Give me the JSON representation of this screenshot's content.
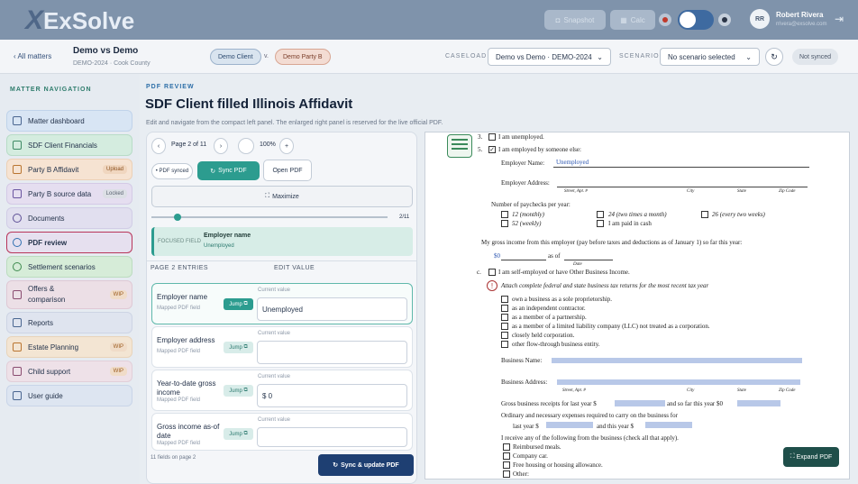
{
  "app": {
    "logo_x": "X",
    "logo_text": "ExSolve"
  },
  "topbar": {
    "snapshot": "Snapshot",
    "calc": "Calc",
    "user_initials": "RR",
    "user_name": "Robert Rivera",
    "user_email": "rrivera@exsolve.com"
  },
  "matter": {
    "all_matters": "‹ All matters",
    "title": "Demo vs Demo",
    "subtitle": "DEMO-2024 · Cook County",
    "party_a": "Demo Client",
    "vs": "v.",
    "party_b": "Demo Party B"
  },
  "caseload": {
    "label": "CASELOAD",
    "value": "Demo vs Demo · DEMO-2024",
    "scenario_label": "SCENARIO",
    "scenario_value": "No scenario selected",
    "sync_status": "Not synced"
  },
  "sidebar": {
    "title": "MATTER NAVIGATION",
    "items": [
      {
        "label": "Matter dashboard",
        "tag": ""
      },
      {
        "label": "SDF Client Financials",
        "tag": ""
      },
      {
        "label": "Party B Affidavit",
        "tag": "Upload"
      },
      {
        "label": "Party B source data",
        "tag": "Locked"
      },
      {
        "label": "Documents",
        "tag": ""
      },
      {
        "label": "PDF review",
        "tag": ""
      },
      {
        "label": "Settlement scenarios",
        "tag": ""
      },
      {
        "label": "Offers & comparison",
        "tag": "WIP"
      },
      {
        "label": "Reports",
        "tag": ""
      },
      {
        "label": "Estate Planning",
        "tag": "WIP"
      },
      {
        "label": "Child support",
        "tag": "WIP"
      },
      {
        "label": "User guide",
        "tag": ""
      }
    ]
  },
  "page": {
    "section": "PDF REVIEW",
    "title": "SDF Client filled Illinois Affidavit",
    "desc": "Edit and navigate from the compact left panel. The enlarged right panel is reserved for the live official PDF."
  },
  "controls": {
    "page_label": "Page 2 of 11",
    "zoom": "100%",
    "pdf_synced": "• PDF synced",
    "sync_pdf": "Sync PDF",
    "open_pdf": "Open PDF",
    "maximize": "Maximize",
    "page_counter": "2/11",
    "focused_label": "FOCUSED FIELD",
    "focused_name": "Employer name",
    "focused_value": "Unemployed"
  },
  "entries": {
    "header_left": "PAGE 2 ENTRIES",
    "header_right": "EDIT VALUE",
    "jump": "Jump",
    "current_value": "Current value",
    "mapped": "Mapped PDF field",
    "items": [
      {
        "name": "Employer name",
        "value": "Unemployed"
      },
      {
        "name": "Employer address",
        "value": ""
      },
      {
        "name": "Year-to-date gross income",
        "value": "$ 0"
      },
      {
        "name": "Gross income as-of date",
        "value": ""
      }
    ],
    "footer": "11 fields on page 2",
    "sync_update": "Sync & update PDF"
  },
  "pdf": {
    "l1_num": "3.",
    "l1": "I am unemployed.",
    "l2_num": "5.",
    "l2": "I am employed by someone else:",
    "emp_name_label": "Employer Name:",
    "emp_name_value": "Unemployed",
    "emp_addr_label": "Employer Address:",
    "street": "Street, Apt. #",
    "city": "City",
    "state": "State",
    "zip": "Zip Code",
    "paychecks": "Number of paychecks per year:",
    "p12": "12 (monthly)",
    "p24": "24 (two times a month)",
    "p26": "26 (every two weeks)",
    "p52": "52 (weekly)",
    "pcash": "I am paid in cash",
    "gross_line": "My gross income from this employer (pay before taxes and deductions as of January 1) so far this year:",
    "gross_value": "$0",
    "as_of": "as of",
    "date": "Date",
    "se_num": "c.",
    "self_emp": "I am self-employed or have Other Business Income.",
    "attach": "Attach complete federal and state business tax returns for the most recent tax year",
    "b1": "own a business as a sole proprietorship.",
    "b2": "as an independent contractor.",
    "b3": "as a member of a partnership.",
    "b4": "as a member of a limited liability company (LLC) not treated as a corporation.",
    "b5": "closely held corporation.",
    "b6": "other flow-through business entity.",
    "biz_name": "Business Name:",
    "biz_addr": "Business Address:",
    "receipts": "Gross business receipts for last year $",
    "receipts2": "and so far this year $0",
    "expenses": "Ordinary and necessary expenses required to carry on the business for",
    "last_year": "last year $",
    "this_year": "and this year $",
    "receive": "I receive any of the following from the business (check all that apply).",
    "r1": "Reimbursed meals.",
    "r2": "Company car.",
    "r3": "Free housing or housing allowance.",
    "r4": "Other:"
  },
  "expand": "Expand PDF"
}
